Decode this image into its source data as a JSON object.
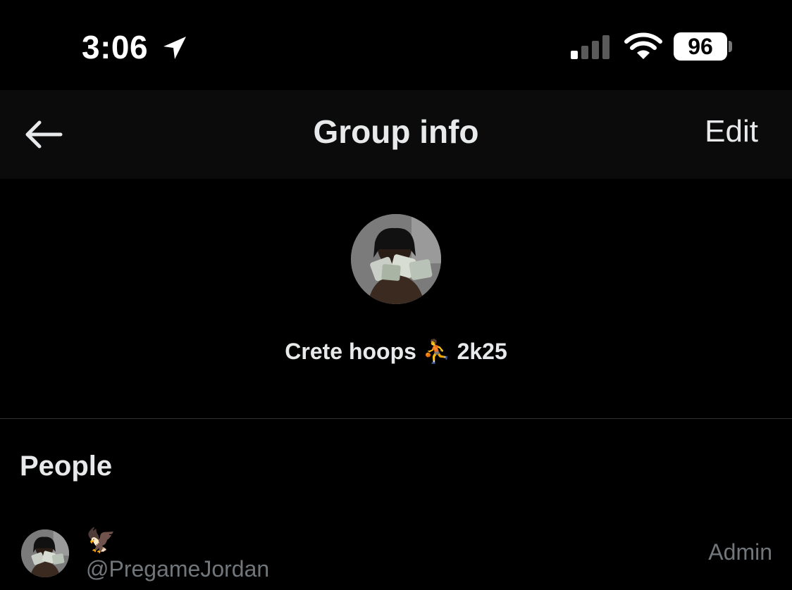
{
  "status_bar": {
    "time": "3:06",
    "battery": "96",
    "icons": [
      "location-arrow-icon",
      "signal-icon",
      "wifi-icon",
      "battery-icon"
    ]
  },
  "header": {
    "back_icon": "arrow-left-icon",
    "title": "Group info",
    "edit_label": "Edit"
  },
  "group": {
    "name": "Crete hoops ⛹️ 2k25"
  },
  "people": {
    "section_title": "People",
    "members": [
      {
        "name": "🦅",
        "handle": "@PregameJordan",
        "role": "Admin"
      }
    ]
  }
}
